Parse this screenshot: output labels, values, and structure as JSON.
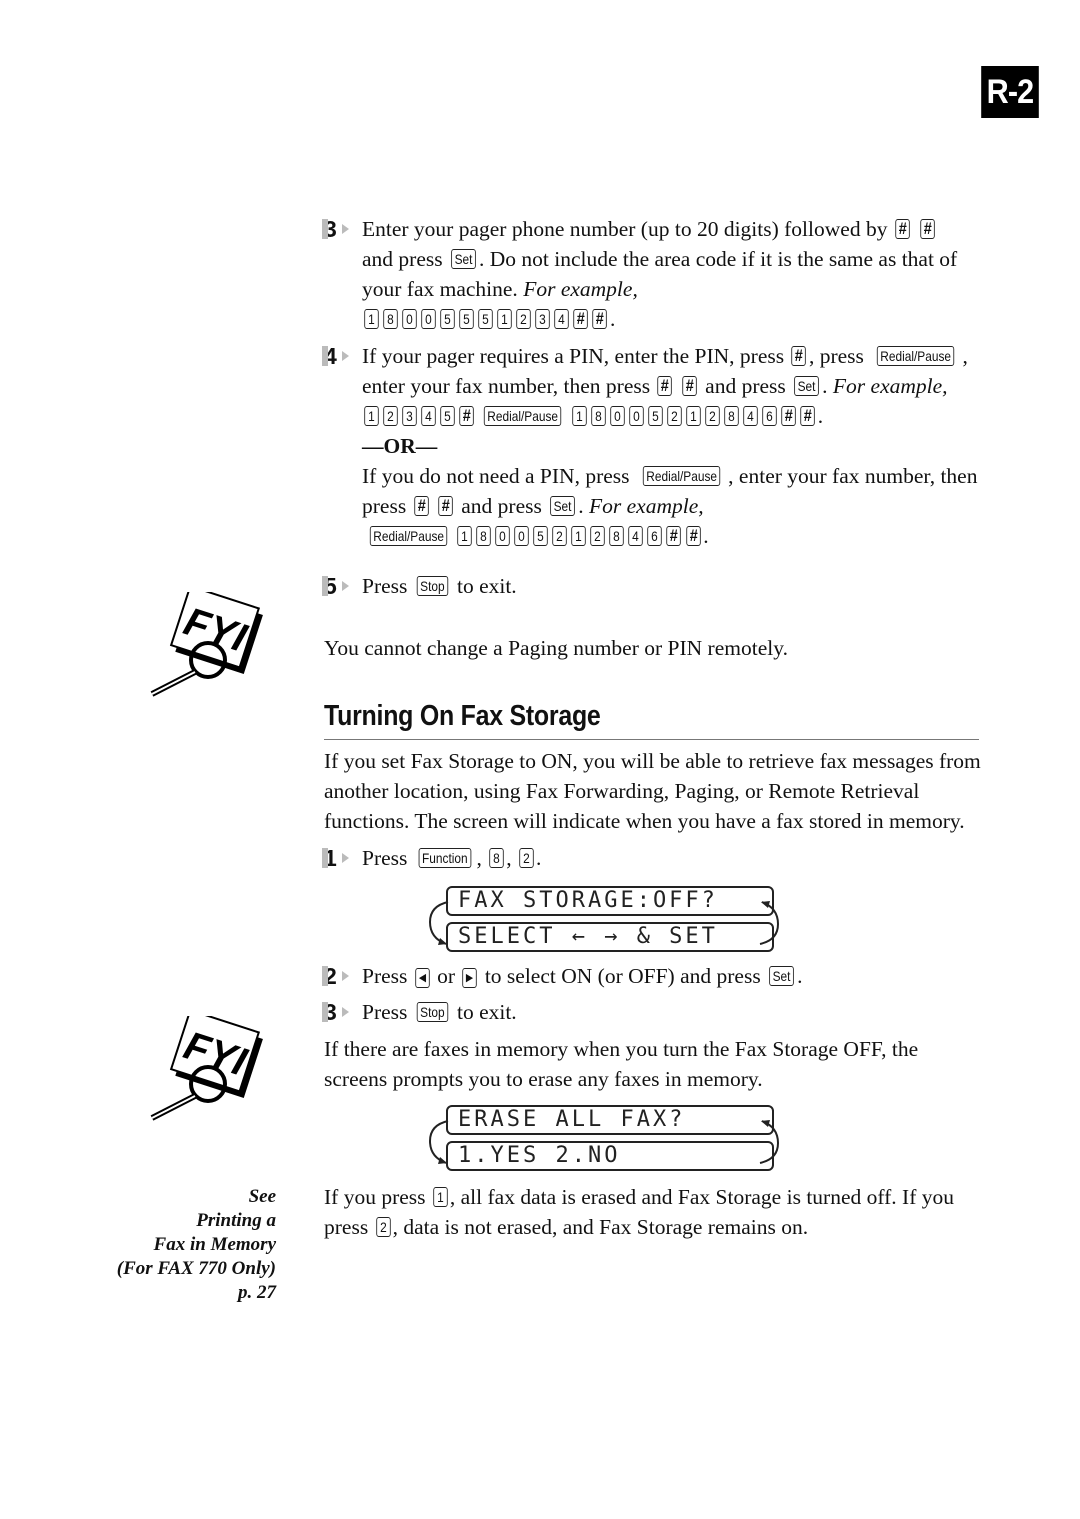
{
  "page_tab": "R-2",
  "steps_top": [
    {
      "num": "3",
      "lines": [
        [
          {
            "t": "Enter your pager phone number (up to 20 digits) followed by "
          },
          {
            "k": "#"
          },
          {
            "t": " "
          },
          {
            "k": "#"
          }
        ],
        [
          {
            "t": "and press "
          },
          {
            "k": "Set"
          },
          {
            "t": ". Do not include the area code if it is the same as that of"
          }
        ],
        [
          {
            "t": "your fax machine.  "
          },
          {
            "i": "For example,"
          }
        ],
        [
          {
            "k": "1"
          },
          {
            "k": "8"
          },
          {
            "k": "0"
          },
          {
            "k": "0"
          },
          {
            "k": "5"
          },
          {
            "k": "5"
          },
          {
            "k": "5"
          },
          {
            "k": "1"
          },
          {
            "k": "2"
          },
          {
            "k": "3"
          },
          {
            "k": "4"
          },
          {
            "k": "#"
          },
          {
            "k": "#"
          },
          {
            "t": "."
          }
        ]
      ]
    },
    {
      "num": "4",
      "lines": [
        [
          {
            "t": "If your pager requires a PIN, enter the PIN, press "
          },
          {
            "k": "#"
          },
          {
            "t": ", press "
          },
          {
            "k": "Redial/Pause"
          },
          {
            "t": ","
          }
        ],
        [
          {
            "t": "enter your fax number, then press "
          },
          {
            "k": "#"
          },
          {
            "t": " "
          },
          {
            "k": "#"
          },
          {
            "t": " and press "
          },
          {
            "k": "Set"
          },
          {
            "t": ". "
          },
          {
            "i": "For example,"
          }
        ],
        [
          {
            "k": "1"
          },
          {
            "k": "2"
          },
          {
            "k": "3"
          },
          {
            "k": "4"
          },
          {
            "k": "5"
          },
          {
            "k": "#"
          },
          {
            "k": "Redial/Pause"
          },
          {
            "k": "1"
          },
          {
            "k": "8"
          },
          {
            "k": "0"
          },
          {
            "k": "0"
          },
          {
            "k": "5"
          },
          {
            "k": "2"
          },
          {
            "k": "1"
          },
          {
            "k": "2"
          },
          {
            "k": "8"
          },
          {
            "k": "4"
          },
          {
            "k": "6"
          },
          {
            "k": "#"
          },
          {
            "k": "#"
          },
          {
            "t": "."
          }
        ],
        [
          {
            "b": "—OR—"
          }
        ],
        [
          {
            "t": "If you do not need a PIN, press "
          },
          {
            "k": "Redial/Pause"
          },
          {
            "t": ", enter your fax number, then"
          }
        ],
        [
          {
            "t": "press "
          },
          {
            "k": "#"
          },
          {
            "t": " "
          },
          {
            "k": "#"
          },
          {
            "t": " and press "
          },
          {
            "k": "Set"
          },
          {
            "t": ". "
          },
          {
            "i": "For example,"
          }
        ],
        [
          {
            "k": "Redial/Pause"
          },
          {
            "k": "1"
          },
          {
            "k": "8"
          },
          {
            "k": "0"
          },
          {
            "k": "0"
          },
          {
            "k": "5"
          },
          {
            "k": "2"
          },
          {
            "k": "1"
          },
          {
            "k": "2"
          },
          {
            "k": "8"
          },
          {
            "k": "4"
          },
          {
            "k": "6"
          },
          {
            "k": "#"
          },
          {
            "k": "#"
          },
          {
            "t": "."
          }
        ]
      ]
    },
    {
      "num": "5",
      "lines": [
        [
          {
            "t": "Press "
          },
          {
            "k": "Stop"
          },
          {
            "t": " to exit."
          }
        ]
      ]
    }
  ],
  "fyi_note_1": "You cannot change a Paging number or PIN remotely.",
  "fyi_icon_label": "FYI",
  "section": {
    "title": "Turning On Fax Storage",
    "intro": [
      "If you set Fax Storage to ON, you will be able to retrieve fax messages from",
      "another location, using Fax Forwarding, Paging, or Remote Retrieval",
      "functions.  The screen will indicate when you have a fax stored in memory."
    ],
    "step1": {
      "num": "1",
      "lines": [
        [
          {
            "t": "Press "
          },
          {
            "k": "Function"
          },
          {
            "t": ", "
          },
          {
            "k": "8"
          },
          {
            "t": ", "
          },
          {
            "k": "2"
          },
          {
            "t": "."
          }
        ]
      ]
    },
    "lcd1": [
      "FAX STORAGE:OFF?",
      "SELECT ← → & SET"
    ],
    "step2": {
      "num": "2",
      "lines": [
        [
          {
            "t": "Press "
          },
          {
            "k": "◀"
          },
          {
            "t": " or "
          },
          {
            "k": "▶"
          },
          {
            "t": " to select ON (or OFF) and press "
          },
          {
            "k": "Set"
          },
          {
            "t": "."
          }
        ]
      ]
    },
    "step3": {
      "num": "3",
      "lines": [
        [
          {
            "t": "Press "
          },
          {
            "k": "Stop"
          },
          {
            "t": " to exit."
          }
        ]
      ]
    },
    "note2": [
      "If there are faxes in memory when you turn the Fax Storage OFF, the",
      "screens prompts you to erase any faxes in memory."
    ],
    "lcd2": [
      "ERASE ALL FAX?",
      "1.YES 2.NO"
    ],
    "final": [
      [
        {
          "t": "If you press "
        },
        {
          "k": "1"
        },
        {
          "t": ", all fax data is erased and Fax Storage is turned off.  If you"
        }
      ],
      [
        {
          "t": "press "
        },
        {
          "k": "2"
        },
        {
          "t": ", data is not erased, and Fax Storage remains on."
        }
      ]
    ]
  },
  "sidenote": [
    "See",
    "Printing a",
    "Fax in Memory",
    "(For FAX 770 Only)",
    "p. 27"
  ]
}
